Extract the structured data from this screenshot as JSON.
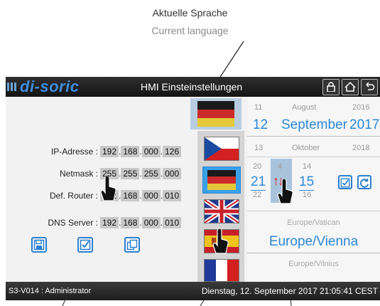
{
  "annotation": {
    "title_de": "Aktuelle Sprache",
    "title_en": "Current language"
  },
  "header": {
    "logo": "di-soric",
    "title": "HMI Einsteinstellungen"
  },
  "network": {
    "ip_label": "IP-Adresse :",
    "ip": [
      "192",
      "168",
      "000",
      "126"
    ],
    "netmask_label": "Netmask :",
    "netmask": [
      "255",
      "255",
      "255",
      "000"
    ],
    "router_label": "Def. Router :",
    "router": [
      "192",
      "168",
      "000",
      "010"
    ],
    "dns_label": "DNS Server :",
    "dns": [
      "192",
      "168",
      "000",
      "010"
    ]
  },
  "date": {
    "prev": {
      "day": "11",
      "month": "August",
      "year": "2016"
    },
    "current": {
      "day": "12",
      "month": "September",
      "year": "2017"
    },
    "next": {
      "day": "13",
      "month": "Oktober",
      "year": "2018"
    }
  },
  "time": {
    "hour_prev": "20",
    "hour_cur": "21",
    "hour_next": "22",
    "min_prev": "4",
    "sec_prev": "14",
    "sec_cur": "15",
    "sec_next": "16"
  },
  "timezone": {
    "prev": "Europe/Vatican",
    "current": "Europe/Vienna",
    "next": "Europe/Vilnius"
  },
  "status": {
    "user": "S3-V014 : Administrator",
    "datetime": "Dienstag, 12. September 2017 21:05:41 CEST"
  },
  "colors": {
    "accent": "#2b88d8",
    "topbar": "#1e1e1e"
  }
}
